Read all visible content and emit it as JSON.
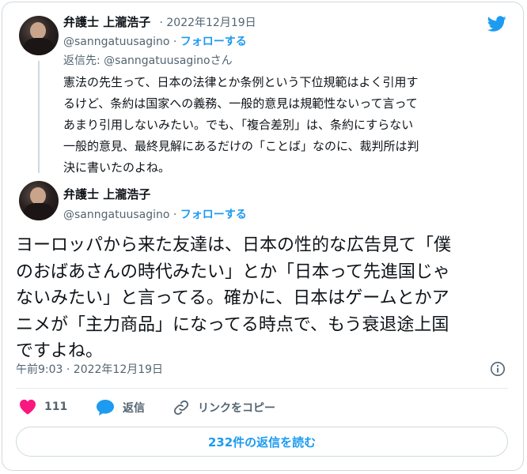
{
  "reply_tweet": {
    "author_name": "弁護士 上瀧浩子",
    "date": "2022年12月19日",
    "handle": "@sanngatuusagino",
    "follow_label": "フォローする",
    "reply_to": "返信先: @sanngatuusaginoさん",
    "text": "憲法の先生って、日本の法律とか条例という下位規範はよく引用す\nるけど、条約は国家への義務、一般的意見は規範性ないって言って\nあまり引用しないみたい。でも、「複合差別」は、条約にすらない\n一般的意見、最終見解にあるだけの「ことば」なのに、裁判所は判\n決に書いたのよね。"
  },
  "main_tweet": {
    "author_name": "弁護士 上瀧浩子",
    "handle": "@sanngatuusagino",
    "follow_label": "フォローする",
    "text": "ヨーロッパから来た友達は、日本の性的な広告見て「僕\nのおばあさんの時代みたい」とか「日本って先進国じゃ\nないみたい」と言ってる。確かに、日本はゲームとかア\nニメが「主力商品」になってる時点で、もう衰退途上国\nですよね。",
    "timestamp": "午前9:03 · 2022年12月19日"
  },
  "actions": {
    "like_count": "111",
    "reply_label": "返信",
    "copy_link_label": "リンクをコピー"
  },
  "read_replies_label": "232件の返信を読む",
  "separator": "·",
  "icons": {
    "brand": "twitter-bird-icon",
    "info": "info-icon",
    "like": "heart-icon",
    "reply": "speech-bubble-icon",
    "copy_link": "link-icon"
  },
  "colors": {
    "accent": "#1d9bf0",
    "like": "#f91880",
    "text": "#0f1419",
    "secondary": "#536471",
    "border": "#cfd9de"
  }
}
